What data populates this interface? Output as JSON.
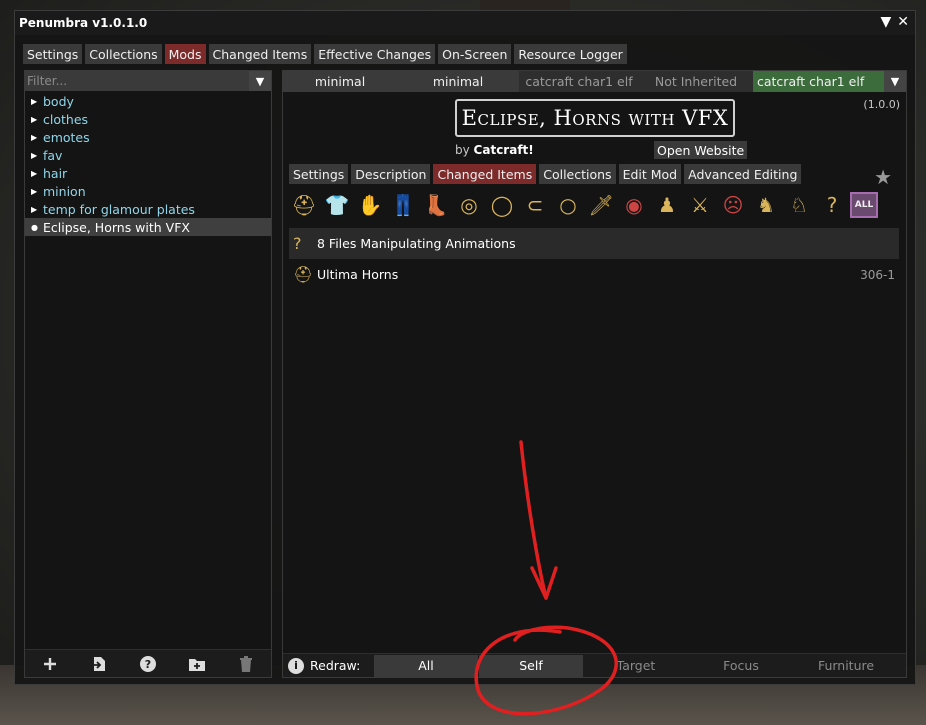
{
  "window": {
    "title": "Penumbra v1.0.1.0"
  },
  "main_tabs": [
    {
      "label": "Settings",
      "active": false
    },
    {
      "label": "Collections",
      "active": false
    },
    {
      "label": "Mods",
      "active": true
    },
    {
      "label": "Changed Items",
      "active": false
    },
    {
      "label": "Effective Changes",
      "active": false
    },
    {
      "label": "On-Screen",
      "active": false
    },
    {
      "label": "Resource Logger",
      "active": false
    }
  ],
  "filter": {
    "placeholder": "Filter..."
  },
  "mod_tree": [
    {
      "label": "body"
    },
    {
      "label": "clothes"
    },
    {
      "label": "emotes"
    },
    {
      "label": "fav"
    },
    {
      "label": "hair"
    },
    {
      "label": "minion"
    },
    {
      "label": "temp for glamour plates"
    }
  ],
  "selected_mod_label": "Eclipse, Horns with VFX",
  "collections": {
    "seg1": "minimal",
    "seg2": "minimal",
    "seg3": "catcraft char1 elf",
    "seg4": "Not Inherited",
    "seg5": "catcraft char1 elf"
  },
  "mod": {
    "title": "Eclipse, Horns with VFX",
    "version": "(1.0.0)",
    "by_prefix": "by",
    "author": "Catcraft!",
    "open_website": "Open Website"
  },
  "mod_tabs": [
    {
      "label": "Settings",
      "active": false
    },
    {
      "label": "Description",
      "active": false
    },
    {
      "label": "Changed Items",
      "active": true
    },
    {
      "label": "Collections",
      "active": false
    },
    {
      "label": "Edit Mod",
      "active": false
    },
    {
      "label": "Advanced Editing",
      "active": false
    }
  ],
  "category_icons": [
    {
      "name": "head-icon",
      "glyph": "⛑"
    },
    {
      "name": "body-icon",
      "glyph": "👕"
    },
    {
      "name": "hands-icon",
      "glyph": "✋"
    },
    {
      "name": "legs-icon",
      "glyph": "👖"
    },
    {
      "name": "feet-icon",
      "glyph": "👢"
    },
    {
      "name": "earring-icon",
      "glyph": "◎"
    },
    {
      "name": "necklace-icon",
      "glyph": "◯"
    },
    {
      "name": "bracelet-icon",
      "glyph": "⊂"
    },
    {
      "name": "ring-icon",
      "glyph": "○"
    },
    {
      "name": "weapon-icon",
      "glyph": "🗡"
    },
    {
      "name": "offhand-icon",
      "glyph": "◉"
    },
    {
      "name": "customization-icon",
      "glyph": "♟"
    },
    {
      "name": "action-icon",
      "glyph": "⚔"
    },
    {
      "name": "emote-icon",
      "glyph": "☹"
    },
    {
      "name": "mount-icon",
      "glyph": "♞"
    },
    {
      "name": "companion-icon",
      "glyph": "♘"
    },
    {
      "name": "unknown-icon",
      "glyph": "?"
    }
  ],
  "all_filter_label": "ALL",
  "changed_items": {
    "header": {
      "icon": "?",
      "label": "8 Files Manipulating Animations"
    },
    "rows": [
      {
        "icon": "⛑",
        "label": "Ultima Horns",
        "id": "306-1"
      }
    ]
  },
  "redraw": {
    "label": "Redraw:",
    "buttons": [
      {
        "label": "All",
        "enabled": true
      },
      {
        "label": "Self",
        "enabled": true
      },
      {
        "label": "Target",
        "enabled": false
      },
      {
        "label": "Focus",
        "enabled": false
      },
      {
        "label": "Furniture",
        "enabled": false
      }
    ]
  },
  "colors": {
    "active_tab": "#7c2a2a",
    "tree_text": "#8fd6ea",
    "collection_green": "#3c6b3c",
    "annotation_red": "#e02020"
  }
}
